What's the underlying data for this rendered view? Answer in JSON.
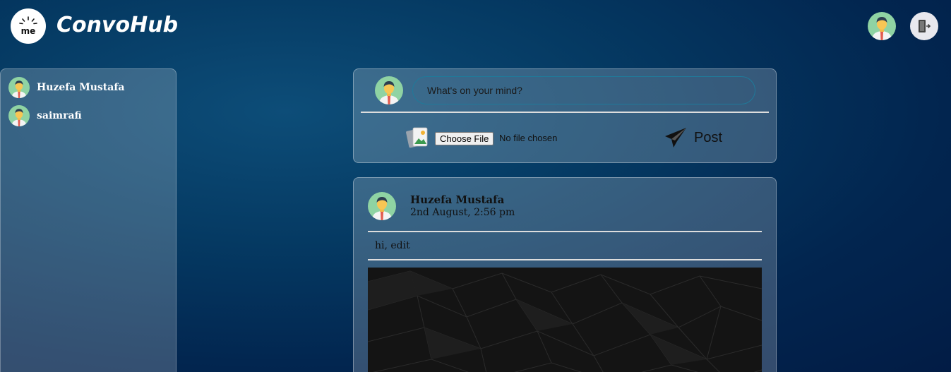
{
  "header": {
    "logo_text": "me",
    "brand": "ConvoHub"
  },
  "sidebar": {
    "users": [
      {
        "name": "Huzefa Mustafa"
      },
      {
        "name": "saimrafi"
      }
    ]
  },
  "composer": {
    "placeholder": "What's on your mind?",
    "file_button": "Choose File",
    "file_status": "No file chosen",
    "post_label": "Post"
  },
  "post": {
    "author": "Huzefa Mustafa",
    "date": "2nd August, 2:56 pm",
    "text": "hi, edit"
  },
  "icons": {
    "avatar": "user-avatar-icon",
    "logout": "logout-icon",
    "image": "image-upload-icon",
    "send": "paper-plane-icon"
  }
}
